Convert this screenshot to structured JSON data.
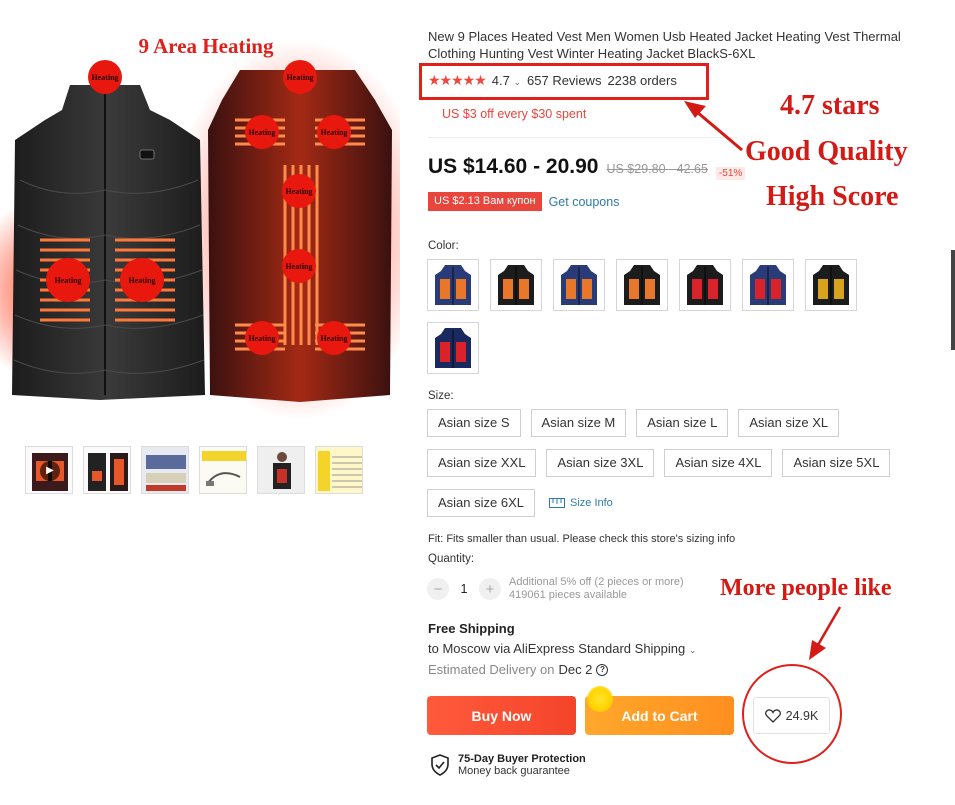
{
  "gallery": {
    "headline": "9 Area Heating",
    "heating_label": "Heating",
    "thumbnails": [
      "video-thumb",
      "vest-black-thumb",
      "vest-detail-thumb",
      "usb-cable-thumb",
      "model-thumb",
      "size-chart-thumb"
    ]
  },
  "product": {
    "title": "New 9 Places Heated Vest Men Women Usb Heated Jacket Heating Vest Thermal Clothing Hunting Vest Winter Heating Jacket BlackS-6XL",
    "rating": {
      "stars": "★★★★★",
      "score": "4.7",
      "reviews": "657 Reviews",
      "orders": "2238 orders"
    },
    "promo": "US $3 off every $30 spent",
    "price": "US $14.60 - 20.90",
    "old_price": "US $29.80 - 42.65",
    "discount": "-51%",
    "coupon_tag": "US $2.13 Вам купон",
    "coupon_link": "Get coupons"
  },
  "color": {
    "label": "Color:",
    "swatches": [
      {
        "body": "#2a3c78",
        "panel": "#e8772a"
      },
      {
        "body": "#1c1c1c",
        "panel": "#e8772a"
      },
      {
        "body": "#2a3c78",
        "panel": "#e8772a"
      },
      {
        "body": "#1c1c1c",
        "panel": "#e8772a"
      },
      {
        "body": "#1c1c1c",
        "panel": "#d8232a"
      },
      {
        "body": "#2a3c78",
        "panel": "#d8232a"
      },
      {
        "body": "#1c1c1c",
        "panel": "#d8a21c"
      },
      {
        "body": "#1a2a5e",
        "panel": "#d8232a"
      }
    ]
  },
  "size": {
    "label": "Size:",
    "rows": [
      [
        "Asian size S",
        "Asian size M",
        "Asian size L",
        "Asian size XL"
      ],
      [
        "Asian size XXL",
        "Asian size 3XL",
        "Asian size 4XL",
        "Asian size 5XL"
      ],
      [
        "Asian size 6XL"
      ]
    ],
    "size_info": "Size Info"
  },
  "fit": "Fit: Fits smaller than usual. Please check this store's sizing info",
  "quantity": {
    "label": "Quantity:",
    "value": "1",
    "note_line1": "Additional 5% off (2 pieces or more)",
    "note_line2": "419061 pieces available"
  },
  "shipping": {
    "free": "Free Shipping",
    "to": "to Moscow via AliExpress Standard Shipping",
    "delivery_label": "Estimated Delivery on",
    "delivery_date": "Dec 2"
  },
  "actions": {
    "buy_now": "Buy Now",
    "add_to_cart": "Add to Cart",
    "wishlist_count": "24.9K"
  },
  "protection": {
    "title": "75-Day Buyer Protection",
    "subtitle": "Money back guarantee"
  },
  "annotations": {
    "stars": "4.7 stars",
    "good_quality": "Good Quality",
    "high_score": "High Score",
    "more_people": "More people like"
  },
  "colors": {
    "accent": "#e8453c",
    "annotation_red": "#d31a14",
    "link_blue": "#2e7aa9",
    "buy_now": "#f4442a",
    "add_to_cart": "#ff9a25"
  }
}
